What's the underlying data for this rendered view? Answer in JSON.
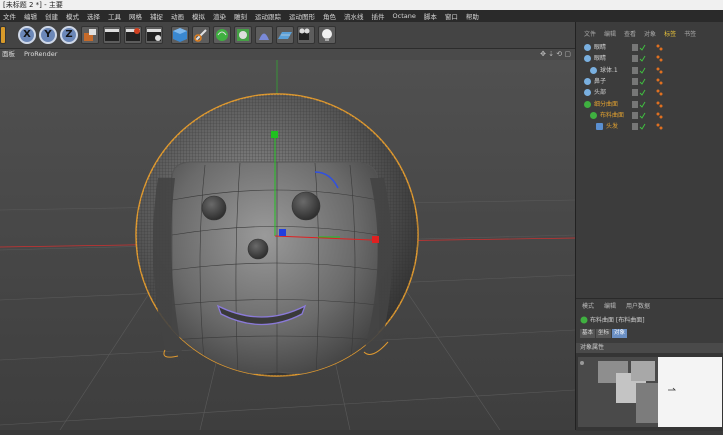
{
  "window": {
    "title": "[未标题 2 *] - 主要"
  },
  "menu": {
    "items": [
      "文件",
      "编辑",
      "创建",
      "模式",
      "选择",
      "工具",
      "网格",
      "捕捉",
      "动画",
      "模拟",
      "渲染",
      "雕刻",
      "运动跟踪",
      "运动图形",
      "角色",
      "流水线",
      "插件",
      "Octane",
      "脚本",
      "窗口",
      "帮助"
    ]
  },
  "toolbar": {
    "axis_x": "X",
    "axis_y": "Y",
    "axis_z": "Z"
  },
  "viewport": {
    "menus": [
      "面板",
      "ProRender"
    ],
    "nav_icons": "✥ ⇣ ⟲ ▢"
  },
  "object_manager": {
    "tabs": [
      "文件",
      "编辑",
      "查看",
      "对象",
      "标签",
      "书签"
    ],
    "active_tab": 4,
    "rows": [
      {
        "name": "眼睛",
        "depth": 0,
        "color": "#d0d0d0",
        "icon": "object-icon"
      },
      {
        "name": "眼睛",
        "depth": 0,
        "color": "#d0d0d0",
        "icon": "object-icon"
      },
      {
        "name": "球体.1",
        "depth": 1,
        "color": "#d0d0d0",
        "icon": "sphere-icon"
      },
      {
        "name": "鼻子",
        "depth": 0,
        "color": "#d0d0d0",
        "icon": "sphere-icon"
      },
      {
        "name": "头部",
        "depth": 0,
        "color": "#d0d0d0",
        "icon": "sphere-icon"
      },
      {
        "name": "细分曲面",
        "depth": 0,
        "color": "#e0a030",
        "icon": "subdivision-icon"
      },
      {
        "name": "布料曲面",
        "depth": 1,
        "color": "#e0a030",
        "icon": "cloth-icon"
      },
      {
        "name": "头发",
        "depth": 2,
        "color": "#e0a030",
        "icon": "hair-icon"
      }
    ]
  },
  "attributes": {
    "tabs": [
      "模式",
      "编辑",
      "用户数据"
    ],
    "object_label": "布料曲面 [布料曲面]",
    "sub_tabs": [
      "基本",
      "坐标",
      "对象"
    ],
    "active_sub_tab": 2,
    "section": "对象属性"
  },
  "colors": {
    "active_tab": "#e8c23a",
    "selection_outline": "#e09a30",
    "axis_x": "#e02020",
    "axis_y": "#20c020",
    "axis_z": "#2040e0"
  }
}
